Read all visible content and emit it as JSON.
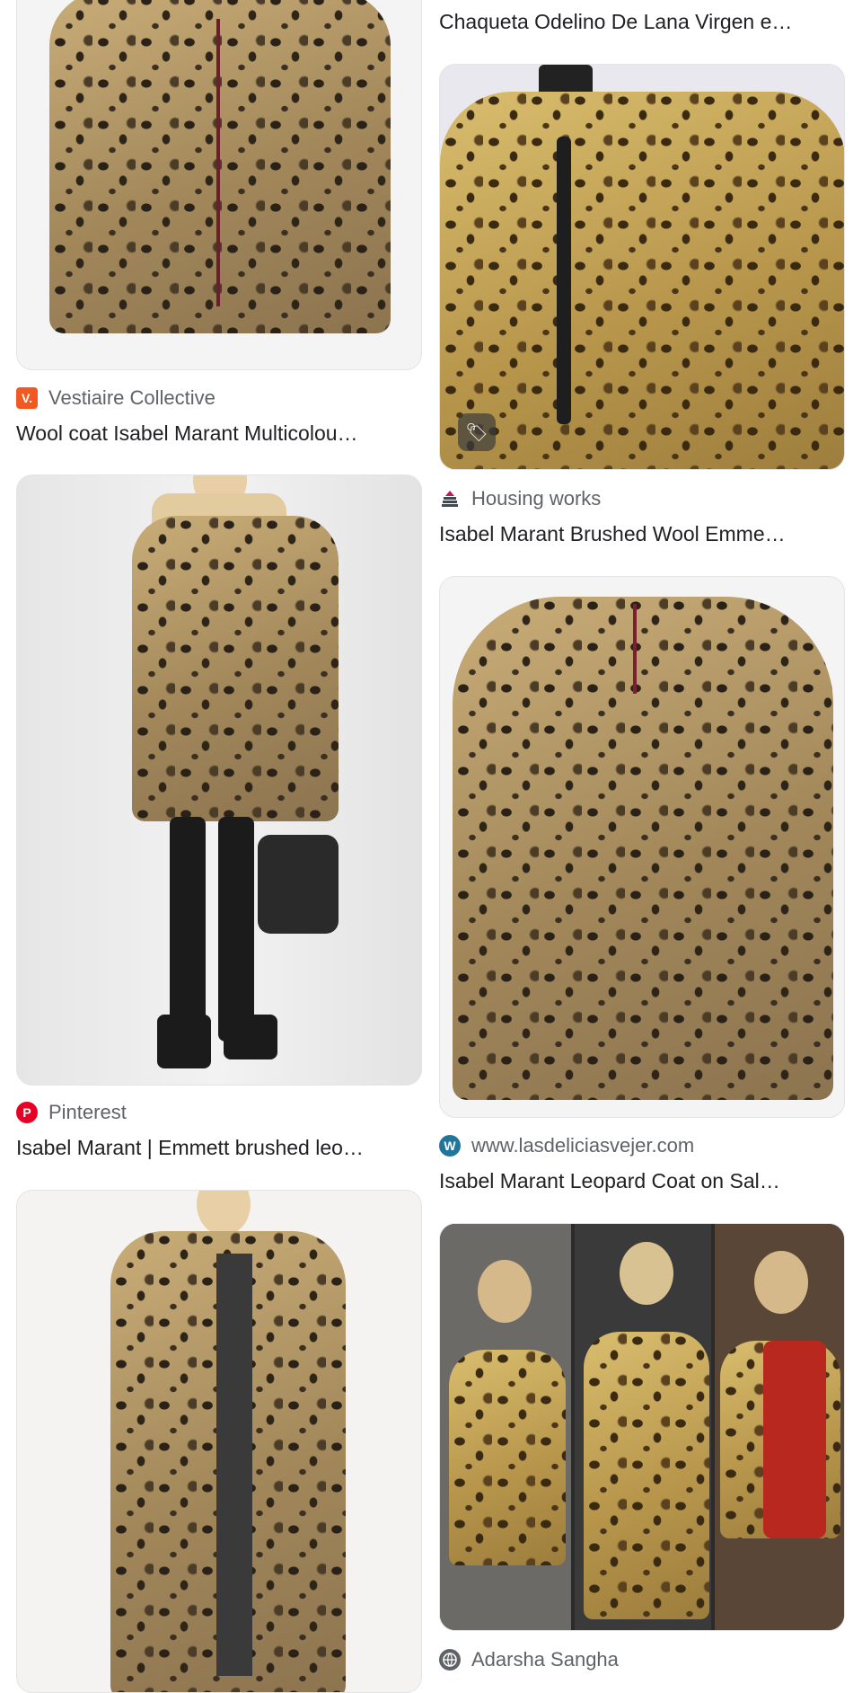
{
  "left_column": [
    {
      "source": "Vestiaire Collective",
      "source_icon": "vestiaire-collective-icon",
      "source_icon_color": "#f05a22",
      "source_icon_glyph": "V.",
      "title": "Wool coat Isabel Marant Multicolou…"
    },
    {
      "source": "Pinterest",
      "source_icon": "pinterest-icon",
      "source_icon_color": "#e60023",
      "source_icon_glyph": "P",
      "title": "Isabel Marant | Emmett brushed leo…"
    },
    {
      "source": "",
      "title": ""
    }
  ],
  "right_column": [
    {
      "title": "Chaqueta Odelino De Lana Virgen e…"
    },
    {
      "source": "Housing works",
      "source_icon": "housing-works-icon",
      "source_icon_color": "#c2185b",
      "title": "Isabel Marant Brushed Wool Emme…",
      "badge_icon": "tag-icon"
    },
    {
      "source": "www.lasdeliciasvejer.com",
      "source_icon": "wordpress-icon",
      "source_icon_color": "#21759b",
      "source_icon_glyph": "W",
      "title": "Isabel Marant Leopard Coat on Sal…"
    },
    {
      "source": "Adarsha Sangha",
      "source_icon": "globe-icon",
      "source_icon_color": "#5f6368",
      "title": ""
    }
  ]
}
